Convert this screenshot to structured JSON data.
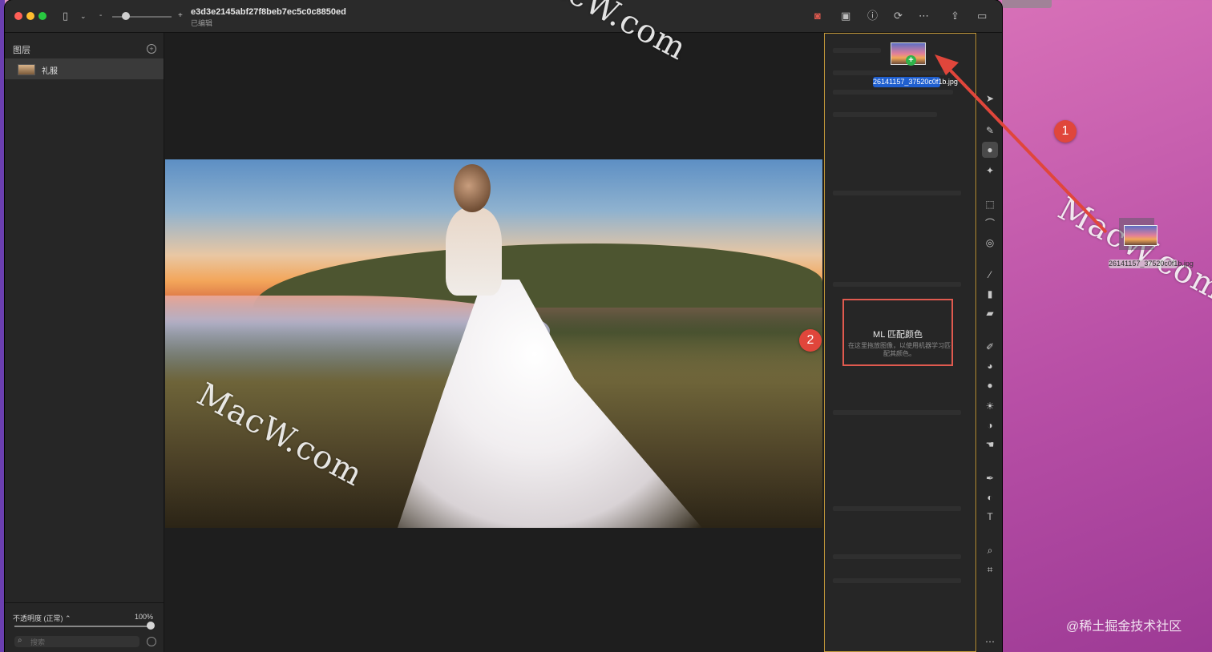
{
  "window": {
    "doc_title": "e3d3e2145abf27f8beb7ec5c0c8850ed",
    "doc_subtitle": "已编辑"
  },
  "sidebar": {
    "header": "图层",
    "layers": [
      {
        "name": "礼服"
      }
    ],
    "opacity_label": "不透明度 (正常) ⌃",
    "opacity_value": "100%",
    "opacity_fraction": 1.0,
    "search_placeholder": "搜索"
  },
  "right_panel": {
    "drop_title": "ML 匹配颜色",
    "drop_desc": "在这里拖放图像，以使用机器学习匹配其颜色。",
    "drag_file_label": "26141157_37520c0f1b.jpg"
  },
  "desktop": {
    "file_label": "26141157_37520c0f1b.jpg",
    "credit": "@稀土掘金技术社区"
  },
  "annotations": {
    "marker_1": "1",
    "marker_2": "2"
  },
  "watermarks": {
    "text": "MacW.com"
  },
  "colors": {
    "accent_border": "#c49a3a",
    "marker_red": "#e0463b",
    "drop_box": "#e05a4f"
  }
}
